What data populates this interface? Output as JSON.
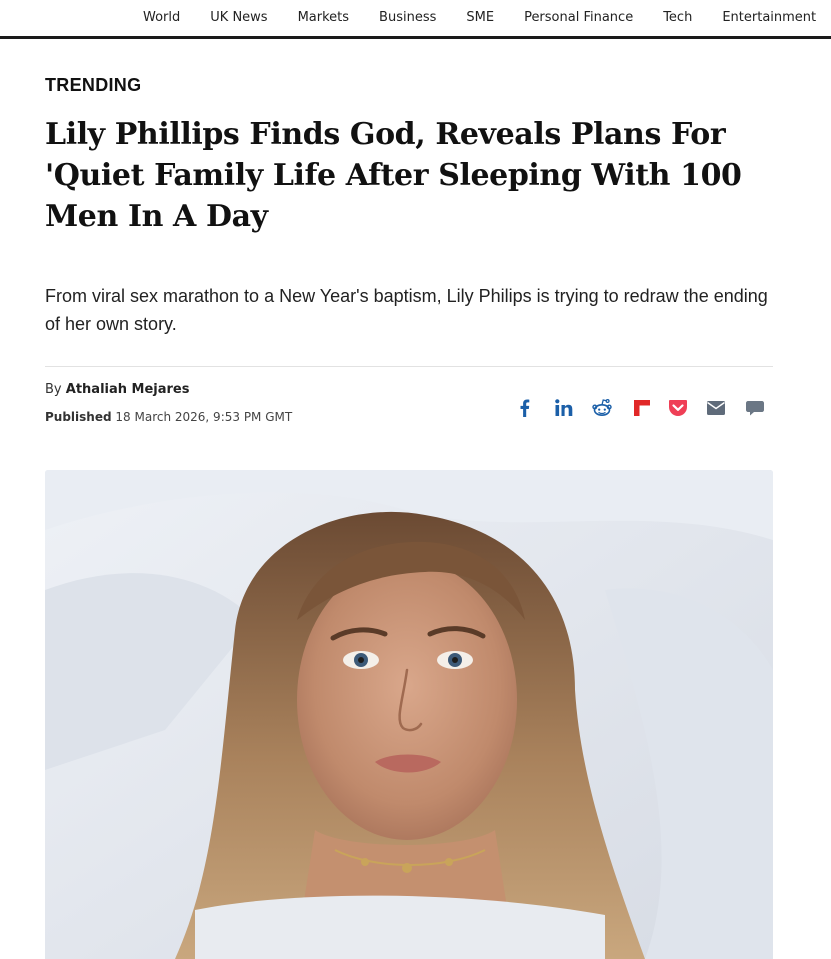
{
  "nav": {
    "items": [
      "World",
      "UK News",
      "Markets",
      "Business",
      "SME",
      "Personal Finance",
      "Tech",
      "Entertainment"
    ]
  },
  "article": {
    "section_label": "TRENDING",
    "headline": "Lily Phillips Finds God, Reveals Plans For 'Quiet Family Life After Sleeping With 100 Men In A Day",
    "standfirst": "From viral sex marathon to a New Year's baptism, Lily Philips is trying to redraw the ending of her own story.",
    "byline_prefix": "By",
    "author": "Athaliah Mejares",
    "published_label": "Published",
    "published_date": "18 March 2026, 9:53 PM GMT"
  },
  "share_icons": [
    "facebook-icon",
    "linkedin-icon",
    "reddit-icon",
    "flipboard-icon",
    "pocket-icon",
    "email-icon",
    "comment-icon"
  ],
  "colors": {
    "share_blue": "#1b5fa8",
    "flipboard_red": "#e12828",
    "pocket_red": "#ef3f56",
    "email_grey": "#5f6b7a",
    "comment_grey": "#6b7785",
    "nav_border": "#1a1a1a"
  }
}
